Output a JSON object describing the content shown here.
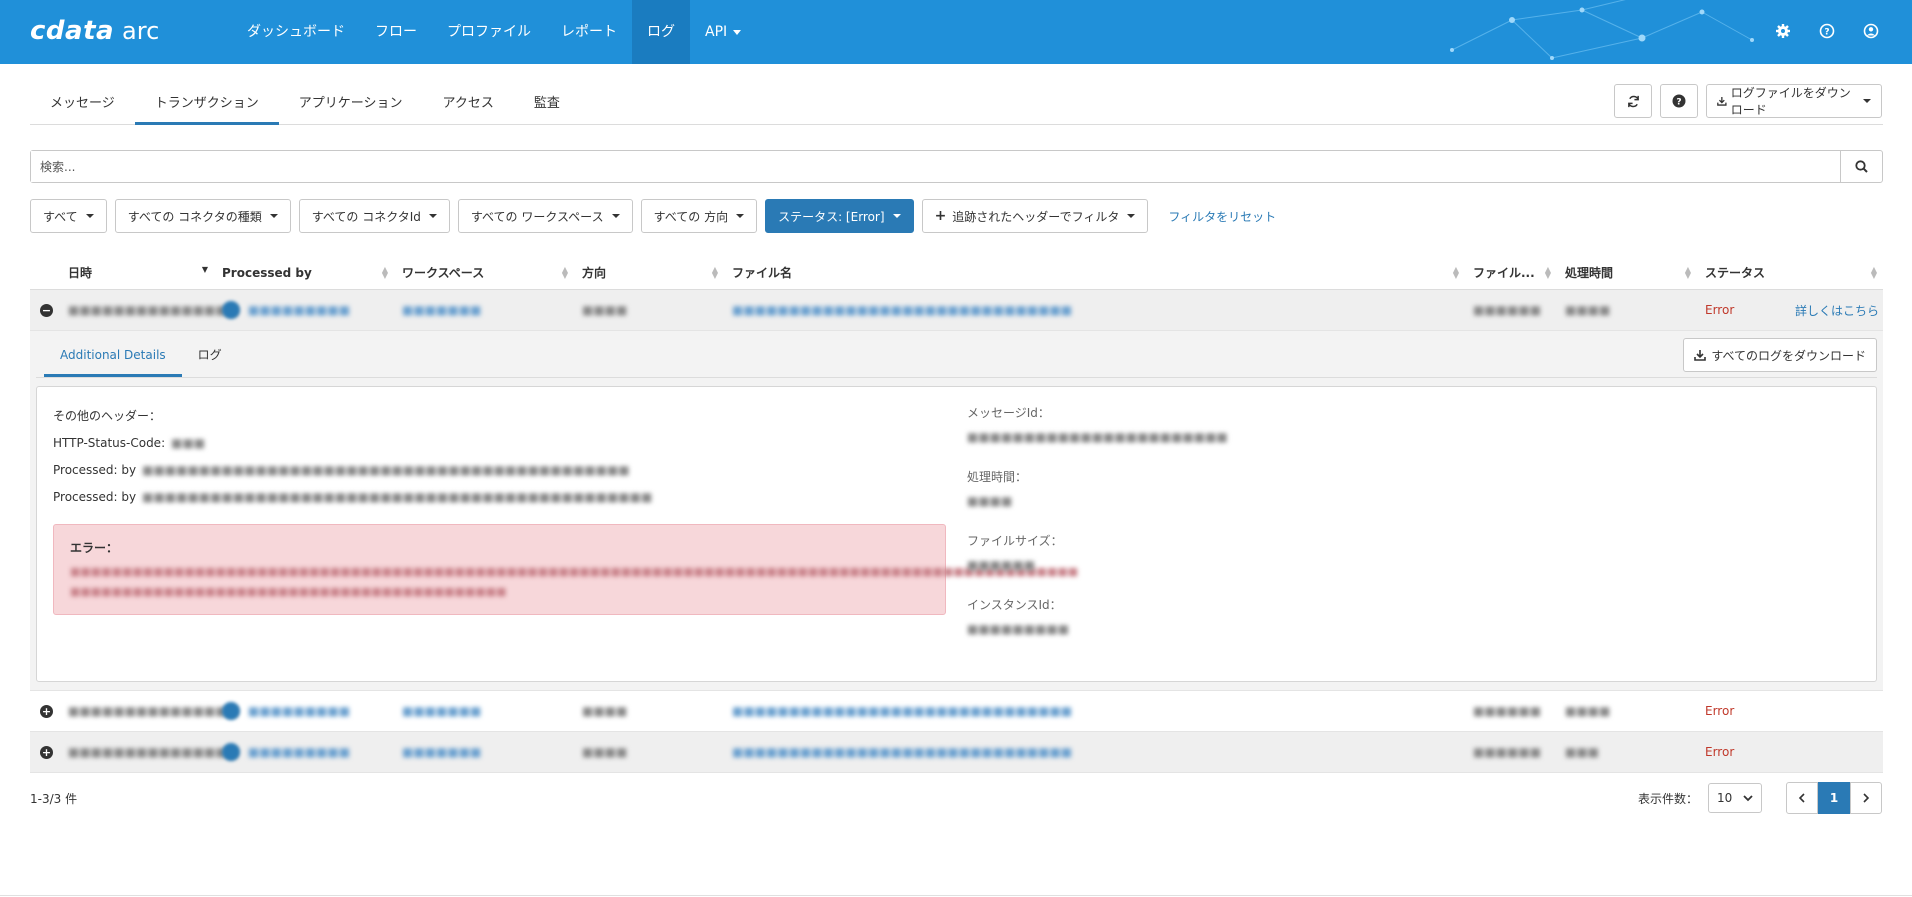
{
  "app": {
    "brand": "cdata",
    "product": "arc"
  },
  "nav": {
    "items": [
      "ダッシュボード",
      "フロー",
      "プロファイル",
      "レポート",
      "ログ"
    ],
    "api_label": "API",
    "active": 4
  },
  "subtabs": [
    "メッセージ",
    "トランザクション",
    "アプリケーション",
    "アクセス",
    "監査"
  ],
  "toolbar": {
    "download_log_label": "ログファイルをダウンロード"
  },
  "search": {
    "placeholder": "検索..."
  },
  "filters": {
    "all": "すべて",
    "connector_type": "すべての コネクタの種類",
    "connector_id": "すべての コネクタId",
    "workspace": "すべての ワークスペース",
    "direction": "すべての 方向",
    "status": "ステータス: [Error]",
    "header_filter": "追跡されたヘッダーでフィルタ",
    "reset": "フィルタをリセット"
  },
  "table": {
    "headers": [
      "日時",
      "Processed by",
      "ワークスペース",
      "方向",
      "ファイル名",
      "ファイル...",
      "処理時間",
      "ステータス"
    ],
    "rows": [
      {
        "status": "Error",
        "detail_link": "詳しくはこちら"
      },
      {
        "status": "Error"
      },
      {
        "status": "Error"
      }
    ]
  },
  "details": {
    "tabs": [
      "Additional Details",
      "ログ"
    ],
    "download_all_label": "すべてのログをダウンロード",
    "other_headers_label": "その他のヘッダー：",
    "http_status_label": "HTTP-Status-Code:",
    "processed_by_label_1": "Processed: by",
    "processed_by_label_2": "Processed: by",
    "error_label": "エラー：",
    "message_id_label": "メッセージId：",
    "processing_time_label": "処理時間：",
    "file_size_label": "ファイルサイズ：",
    "instance_id_label": "インスタンスId："
  },
  "footer": {
    "count": "1-3/3 件",
    "page_size_label": "表示件数：",
    "page_size": "10",
    "current_page": "1"
  },
  "colors": {
    "topbar": "#2090d9",
    "accent": "#2a7ab5",
    "error": "#c0392b",
    "error_bg": "#f7d7da"
  }
}
